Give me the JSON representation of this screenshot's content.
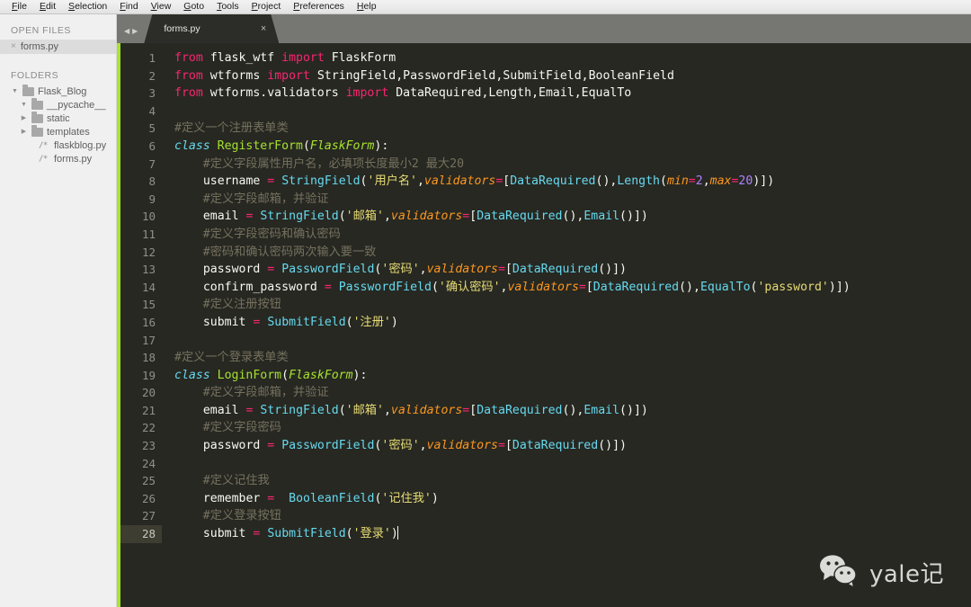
{
  "menubar": {
    "items": [
      {
        "label": "File"
      },
      {
        "label": "Edit"
      },
      {
        "label": "Selection"
      },
      {
        "label": "Find"
      },
      {
        "label": "View"
      },
      {
        "label": "Goto"
      },
      {
        "label": "Tools"
      },
      {
        "label": "Project"
      },
      {
        "label": "Preferences"
      },
      {
        "label": "Help"
      }
    ]
  },
  "sidebar": {
    "open_files_header": "OPEN FILES",
    "open_files": [
      {
        "name": "forms.py",
        "close_icon": "×"
      }
    ],
    "folders_header": "FOLDERS",
    "tree": [
      {
        "twisty": "▼",
        "kind": "folder",
        "label": "Flask_Blog",
        "depth": 0
      },
      {
        "twisty": "▼",
        "kind": "folder",
        "label": "__pycache__",
        "depth": 1
      },
      {
        "twisty": "▶",
        "kind": "folder",
        "label": "static",
        "depth": 1
      },
      {
        "twisty": "▶",
        "kind": "folder",
        "label": "templates",
        "depth": 1
      },
      {
        "twisty": "",
        "kind": "file",
        "icon": "/*",
        "label": "flaskblog.py",
        "depth": 2
      },
      {
        "twisty": "",
        "kind": "file",
        "icon": "/*",
        "label": "forms.py",
        "depth": 2
      }
    ]
  },
  "tabbar": {
    "prev_arrow": "◀",
    "next_arrow": "▶",
    "tabs": [
      {
        "title": "forms.py",
        "close": "×",
        "active": true
      }
    ]
  },
  "editor": {
    "file_name": "forms.py",
    "active_line": 28,
    "line_numbers": [
      1,
      2,
      3,
      4,
      5,
      6,
      7,
      8,
      9,
      10,
      11,
      12,
      13,
      14,
      15,
      16,
      17,
      18,
      19,
      20,
      21,
      22,
      23,
      24,
      25,
      26,
      27,
      28
    ],
    "theme": {
      "background": "#272822",
      "keyword": "#f92672",
      "class_name": "#a6e22e",
      "function": "#66d9ef",
      "string": "#e6db74",
      "comment": "#75715e",
      "parameter": "#fd971f",
      "number": "#ae81ff",
      "plain": "#f8f8f2",
      "active_line": "#3e3d32",
      "accent_strip": "#a6e22e"
    },
    "lines": [
      "from flask_wtf import FlaskForm",
      "from wtforms import StringField,PasswordField,SubmitField,BooleanField",
      "from wtforms.validators import DataRequired,Length,Email,EqualTo",
      "",
      "#定义一个注册表单类",
      "class RegisterForm(FlaskForm):",
      "    #定义字段属性用户名，必填项长度最小2 最大20",
      "    username = StringField('用户名',validators=[DataRequired(),Length(min=2,max=20)])",
      "    #定义字段邮箱，并验证",
      "    email = StringField('邮箱',validators=[DataRequired(),Email()])",
      "    #定义字段密码和确认密码",
      "    #密码和确认密码两次输入要一致",
      "    password = PasswordField('密码',validators=[DataRequired()])",
      "    confirm_password = PasswordField('确认密码',validators=[DataRequired(),EqualTo('password')])",
      "    #定义注册按钮",
      "    submit = SubmitField('注册')",
      "",
      "#定义一个登录表单类",
      "class LoginForm(FlaskForm):",
      "    #定义字段邮箱，并验证",
      "    email = StringField('邮箱',validators=[DataRequired(),Email()])",
      "    #定义字段密码",
      "    password = PasswordField('密码',validators=[DataRequired()])",
      "",
      "    #定义记住我",
      "    remember =  BooleanField('记住我')",
      "    #定义登录按钮",
      "    submit = SubmitField('登录')"
    ]
  },
  "watermark": {
    "icon": "wechat-icon",
    "text": "yale记"
  }
}
